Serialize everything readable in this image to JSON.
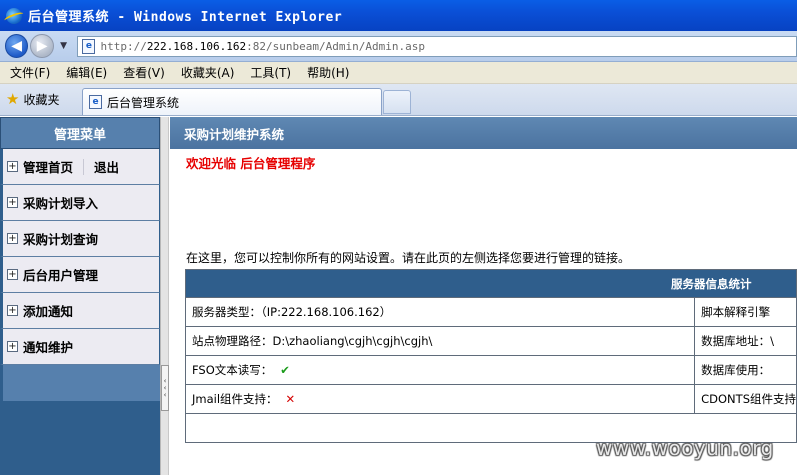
{
  "window": {
    "title": "后台管理系统 - Windows Internet Explorer"
  },
  "address_bar": {
    "url_prefix": "http://",
    "url_host": "222.168.106.162",
    "url_rest": ":82/sunbeam/Admin/Admin.asp"
  },
  "menu": {
    "items": [
      "文件(F)",
      "编辑(E)",
      "查看(V)",
      "收藏夹(A)",
      "工具(T)",
      "帮助(H)"
    ]
  },
  "tabs": {
    "favorites_label": "收藏夹",
    "active_tab": "后台管理系统"
  },
  "sidebar": {
    "header": "管理菜单",
    "items": [
      {
        "label": "管理首页",
        "extra": "退出"
      },
      {
        "label": "采购计划导入"
      },
      {
        "label": "采购计划查询"
      },
      {
        "label": "后台用户管理"
      },
      {
        "label": "添加通知"
      },
      {
        "label": "通知维护"
      }
    ]
  },
  "main": {
    "header": "采购计划维护系统",
    "welcome": "欢迎光临  后台管理程序",
    "intro": "在这里，您可以控制你所有的网站设置。请在此页的左侧选择您要进行管理的链接。",
    "table": {
      "title": "服务器信息统计",
      "rows": [
        {
          "left": "服务器类型：（IP:222.168.106.162）",
          "right": "脚本解释引擎"
        },
        {
          "left": "站点物理路径：D:\\zhaoliang\\cgjh\\cgjh\\cgjh\\",
          "right": "数据库地址：\\"
        },
        {
          "left": "FSO文本读写：",
          "right": "数据库使用："
        },
        {
          "left": "Jmail组件支持：",
          "right": "CDONTS组件支持"
        }
      ]
    }
  },
  "watermark": "www.wooyun.org",
  "colors": {
    "sidebar_bg": "#2f5e8c",
    "header_bg": "#5680ad",
    "welcome_red": "#e60000",
    "check_green": "#1a9b1a",
    "cross_red": "#d40000"
  }
}
